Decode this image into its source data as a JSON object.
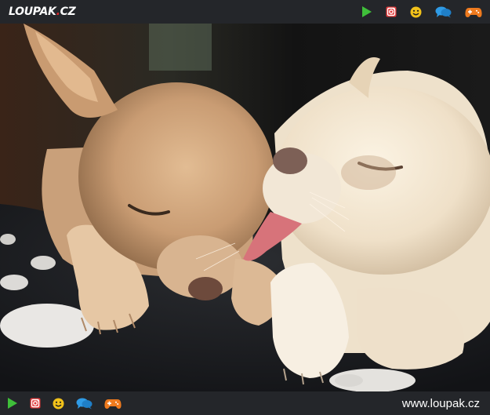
{
  "header": {
    "logo_text": "LOUPAK",
    "logo_dot": ".",
    "logo_tld": "CZ",
    "icons": [
      "play-icon",
      "instagram-icon",
      "smiley-icon",
      "chat-icon",
      "gamepad-icon"
    ]
  },
  "footer": {
    "icons": [
      "play-icon",
      "instagram-icon",
      "smiley-icon",
      "chat-icon",
      "gamepad-icon"
    ],
    "url": "www.loupak.cz"
  },
  "colors": {
    "bar_bg": "#24262a",
    "play": "#3fbf3a",
    "instagram": "#e23a3a",
    "smiley": "#f2c21a",
    "chat": "#2f9be6",
    "gamepad": "#ee7a1e",
    "logo_red": "#e0262b"
  }
}
